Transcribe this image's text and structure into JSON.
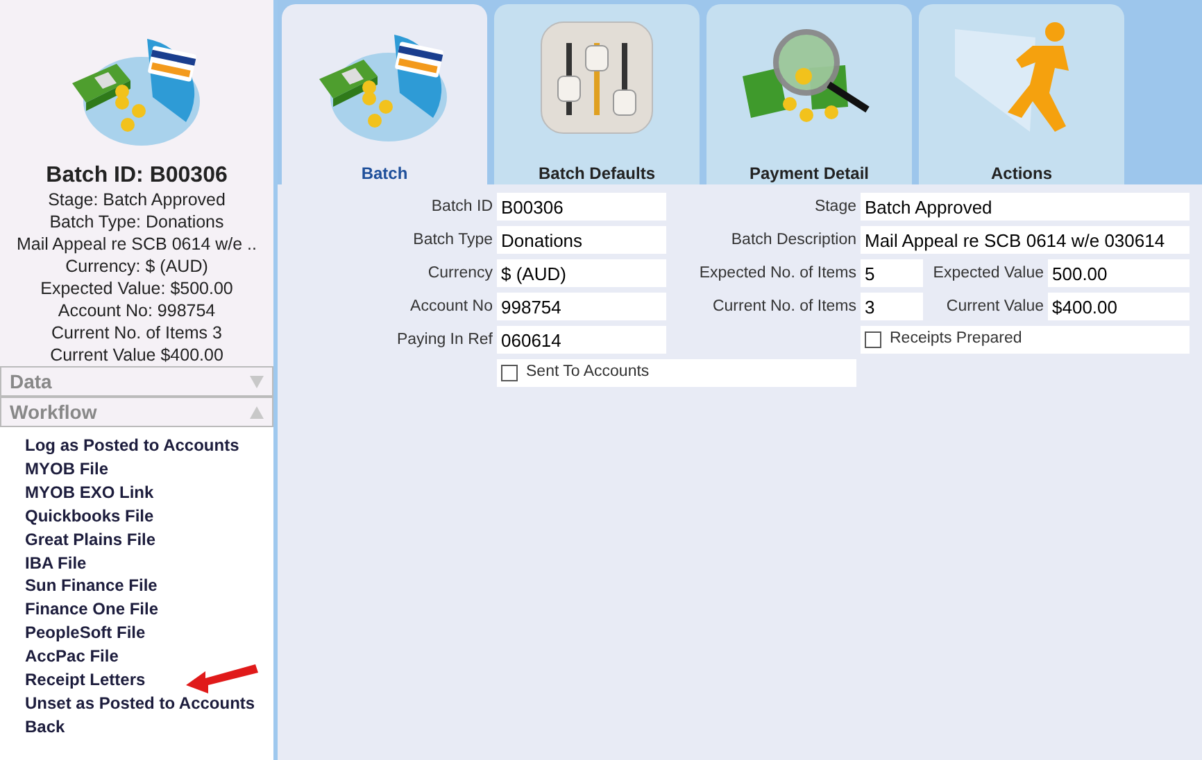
{
  "sidebar": {
    "title": "Batch ID: B00306",
    "summary_lines": [
      "Stage: Batch Approved",
      "Batch Type: Donations",
      "Mail Appeal re SCB 0614 w/e ..",
      "Currency: $ (AUD)",
      "Expected Value: $500.00",
      "Account No: 998754",
      "Current No. of Items 3",
      "Current Value $400.00"
    ],
    "sections": [
      {
        "label": "Data",
        "expanded": false
      },
      {
        "label": "Workflow",
        "expanded": true
      }
    ],
    "workflow_items": [
      {
        "label": "Log as Posted to Accounts",
        "pointed_at": false
      },
      {
        "label": "MYOB File",
        "pointed_at": false
      },
      {
        "label": "MYOB EXO Link",
        "pointed_at": false
      },
      {
        "label": "Quickbooks File",
        "pointed_at": false
      },
      {
        "label": "Great Plains File",
        "pointed_at": false
      },
      {
        "label": "IBA File",
        "pointed_at": false
      },
      {
        "label": "Sun Finance File",
        "pointed_at": false
      },
      {
        "label": "Finance One File",
        "pointed_at": false
      },
      {
        "label": "PeopleSoft File",
        "pointed_at": false
      },
      {
        "label": "AccPac File",
        "pointed_at": false
      },
      {
        "label": "Receipt Letters",
        "pointed_at": true
      },
      {
        "label": "Unset as Posted to Accounts",
        "pointed_at": false
      },
      {
        "label": "Back",
        "pointed_at": false
      }
    ]
  },
  "tabs": [
    {
      "label": "Batch",
      "selected": true,
      "kind": "batch"
    },
    {
      "label": "Batch Defaults",
      "selected": false,
      "kind": "sliders"
    },
    {
      "label": "Payment Detail",
      "selected": false,
      "kind": "magnifier"
    },
    {
      "label": "Actions",
      "selected": false,
      "kind": "runner"
    }
  ],
  "form": {
    "rows": [
      [
        {
          "kind": "field",
          "label": "Batch ID",
          "value": "B00306"
        },
        {
          "kind": "field",
          "label": "Stage",
          "value": "Batch Approved"
        }
      ],
      [
        {
          "kind": "field",
          "label": "Batch Type",
          "value": "Donations"
        },
        {
          "kind": "field",
          "label": "Batch Description",
          "value": "Mail Appeal re SCB 0614 w/e 030614"
        }
      ],
      [
        {
          "kind": "field",
          "label": "Currency",
          "value": "$ (AUD)"
        },
        {
          "kind": "field",
          "label": "Expected No. of Items",
          "value": "5"
        },
        {
          "kind": "field",
          "label": "Expected Value",
          "value": "500.00"
        }
      ],
      [
        {
          "kind": "field",
          "label": "Account No",
          "value": "998754"
        },
        {
          "kind": "field",
          "label": "Current No. of Items",
          "value": "3"
        },
        {
          "kind": "field",
          "label": "Current Value",
          "value": "$400.00"
        }
      ],
      [
        {
          "kind": "field",
          "label": "Paying In Ref",
          "value": "060614"
        },
        {
          "kind": "checkbox",
          "label": "Receipts Prepared",
          "checked": false
        }
      ],
      [
        {
          "kind": "checkbox",
          "label": "Sent To Accounts",
          "checked": false
        }
      ]
    ]
  }
}
